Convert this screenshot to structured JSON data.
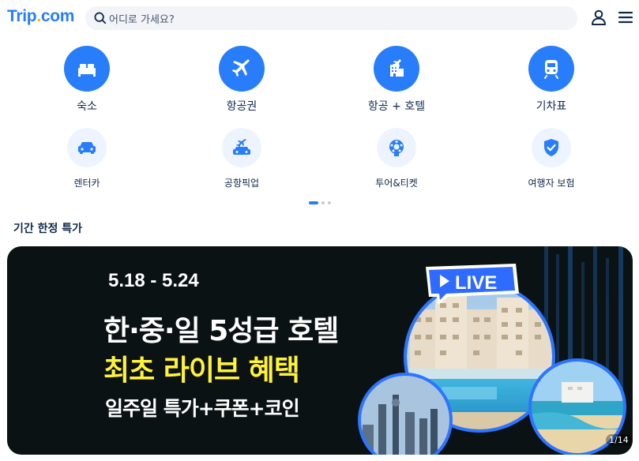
{
  "header": {
    "logo_main": "Trip",
    "logo_dot": ".",
    "logo_suffix": "com",
    "search_placeholder": "어디로 가세요?",
    "icons": [
      "search-icon",
      "user-icon",
      "menu-icon"
    ]
  },
  "categories_primary": [
    {
      "label": "숙소",
      "icon": "bed-icon"
    },
    {
      "label": "항공권",
      "icon": "airplane-icon"
    },
    {
      "label": "항공 + 호텔",
      "icon": "flight-hotel-icon"
    },
    {
      "label": "기차표",
      "icon": "train-icon"
    }
  ],
  "categories_secondary": [
    {
      "label": "렌터카",
      "icon": "car-icon"
    },
    {
      "label": "공항픽업",
      "icon": "airport-pickup-icon"
    },
    {
      "label": "투어&티켓",
      "icon": "tour-ticket-icon"
    },
    {
      "label": "여행자 보험",
      "icon": "shield-icon"
    }
  ],
  "pagination": {
    "current": 1,
    "total": 3
  },
  "section": {
    "title": "기간 한정 특가"
  },
  "banner": {
    "date": "5.18 - 5.24",
    "line1": "한·중·일 5성급 호텔",
    "line2": "최초 라이브 혜택",
    "line3": "일주일 특가+쿠폰+코인",
    "live_badge": "LIVE",
    "counter": "1/14"
  },
  "colors": {
    "brand": "#287dfa",
    "logo_dot": "#ffb200",
    "highlight_text": "#fff23a",
    "banner_bg": "#0b1214"
  }
}
